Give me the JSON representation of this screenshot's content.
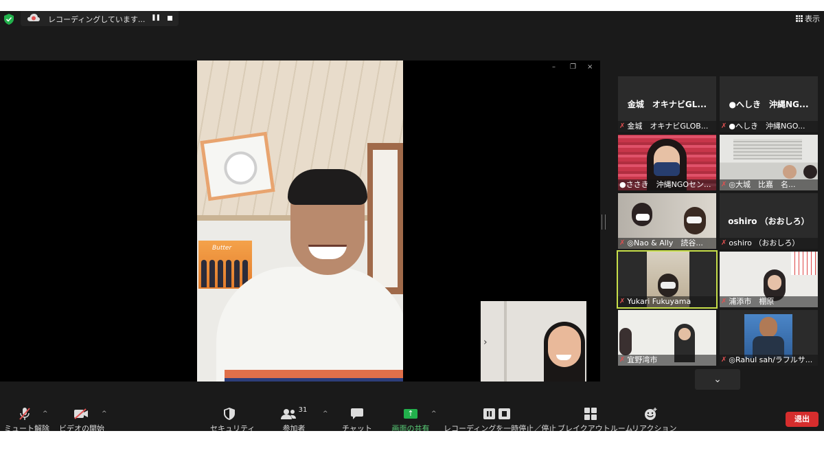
{
  "recording": {
    "status_text": "レコーディングしています...",
    "pause_glyph": "❚❚"
  },
  "top_right": {
    "view_label": "表示"
  },
  "window_controls": {
    "minimize": "–",
    "restore": "❐",
    "close": "×"
  },
  "speaker": {
    "poster_text": "Butter"
  },
  "self_view": {
    "arrow": "›"
  },
  "gallery": {
    "tiles": [
      {
        "center_name": "金城　オキナビGL...",
        "name": "金城　オキナビGLOB..."
      },
      {
        "center_name": "●へしき　沖縄NG...",
        "name": "●へしき　沖縄NGO..."
      },
      {
        "name": "●ささき　沖縄NGOセン..."
      },
      {
        "name": "◎大城　比嘉　名..."
      },
      {
        "name": "◎Nao & Ally　読谷..."
      },
      {
        "center_name": "oshiro （おおしろ）",
        "name": "oshiro （おおしろ）"
      },
      {
        "name": "Yukari Fukuyama"
      },
      {
        "name": "浦添市　棚原"
      },
      {
        "name": "宜野湾市"
      },
      {
        "name": "◎Rahul sah/ラフルサ..."
      }
    ],
    "more_glyph": "⌄"
  },
  "toolbar": {
    "mute": "ミュート解除",
    "video": "ビデオの開始",
    "security": "セキュリティ",
    "participants": "参加者",
    "participants_count": "31",
    "chat": "チャット",
    "share": "画面の共有",
    "recording_ctrl": "レコーディングを一時停止／停止",
    "breakout": "ブレイクアウトルーム",
    "reactions": "リアクション",
    "exit": "退出",
    "caret": "^"
  },
  "colors": {
    "background": "#1a1a1a",
    "share_green": "#22b14c",
    "exit_red": "#d62d2d",
    "active_speaker_border": "#c8e04a",
    "mic_off_red": "#e05050"
  }
}
